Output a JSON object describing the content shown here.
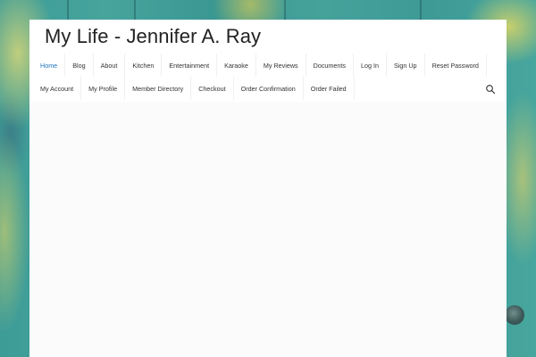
{
  "site": {
    "title": "My Life - Jennifer A. Ray"
  },
  "nav": {
    "row1": [
      {
        "label": "Home",
        "active": true
      },
      {
        "label": "Blog",
        "active": false
      },
      {
        "label": "About",
        "active": false
      },
      {
        "label": "Kitchen",
        "active": false
      },
      {
        "label": "Entertainment",
        "active": false
      },
      {
        "label": "Karaoke",
        "active": false
      },
      {
        "label": "My Reviews",
        "active": false
      },
      {
        "label": "Documents",
        "active": false
      },
      {
        "label": "Log In",
        "active": false
      },
      {
        "label": "Sign Up",
        "active": false
      },
      {
        "label": "Reset Password",
        "active": false
      }
    ],
    "row2": [
      {
        "label": "My Account",
        "active": false
      },
      {
        "label": "My Profile",
        "active": false
      },
      {
        "label": "Member Directory",
        "active": false
      },
      {
        "label": "Checkout",
        "active": false
      },
      {
        "label": "Order Confirmation",
        "active": false
      },
      {
        "label": "Order Failed",
        "active": false
      }
    ],
    "search_icon": "search-icon"
  },
  "colors": {
    "accent": "#1e73be",
    "text": "#333333",
    "background": "#3f9c97"
  }
}
